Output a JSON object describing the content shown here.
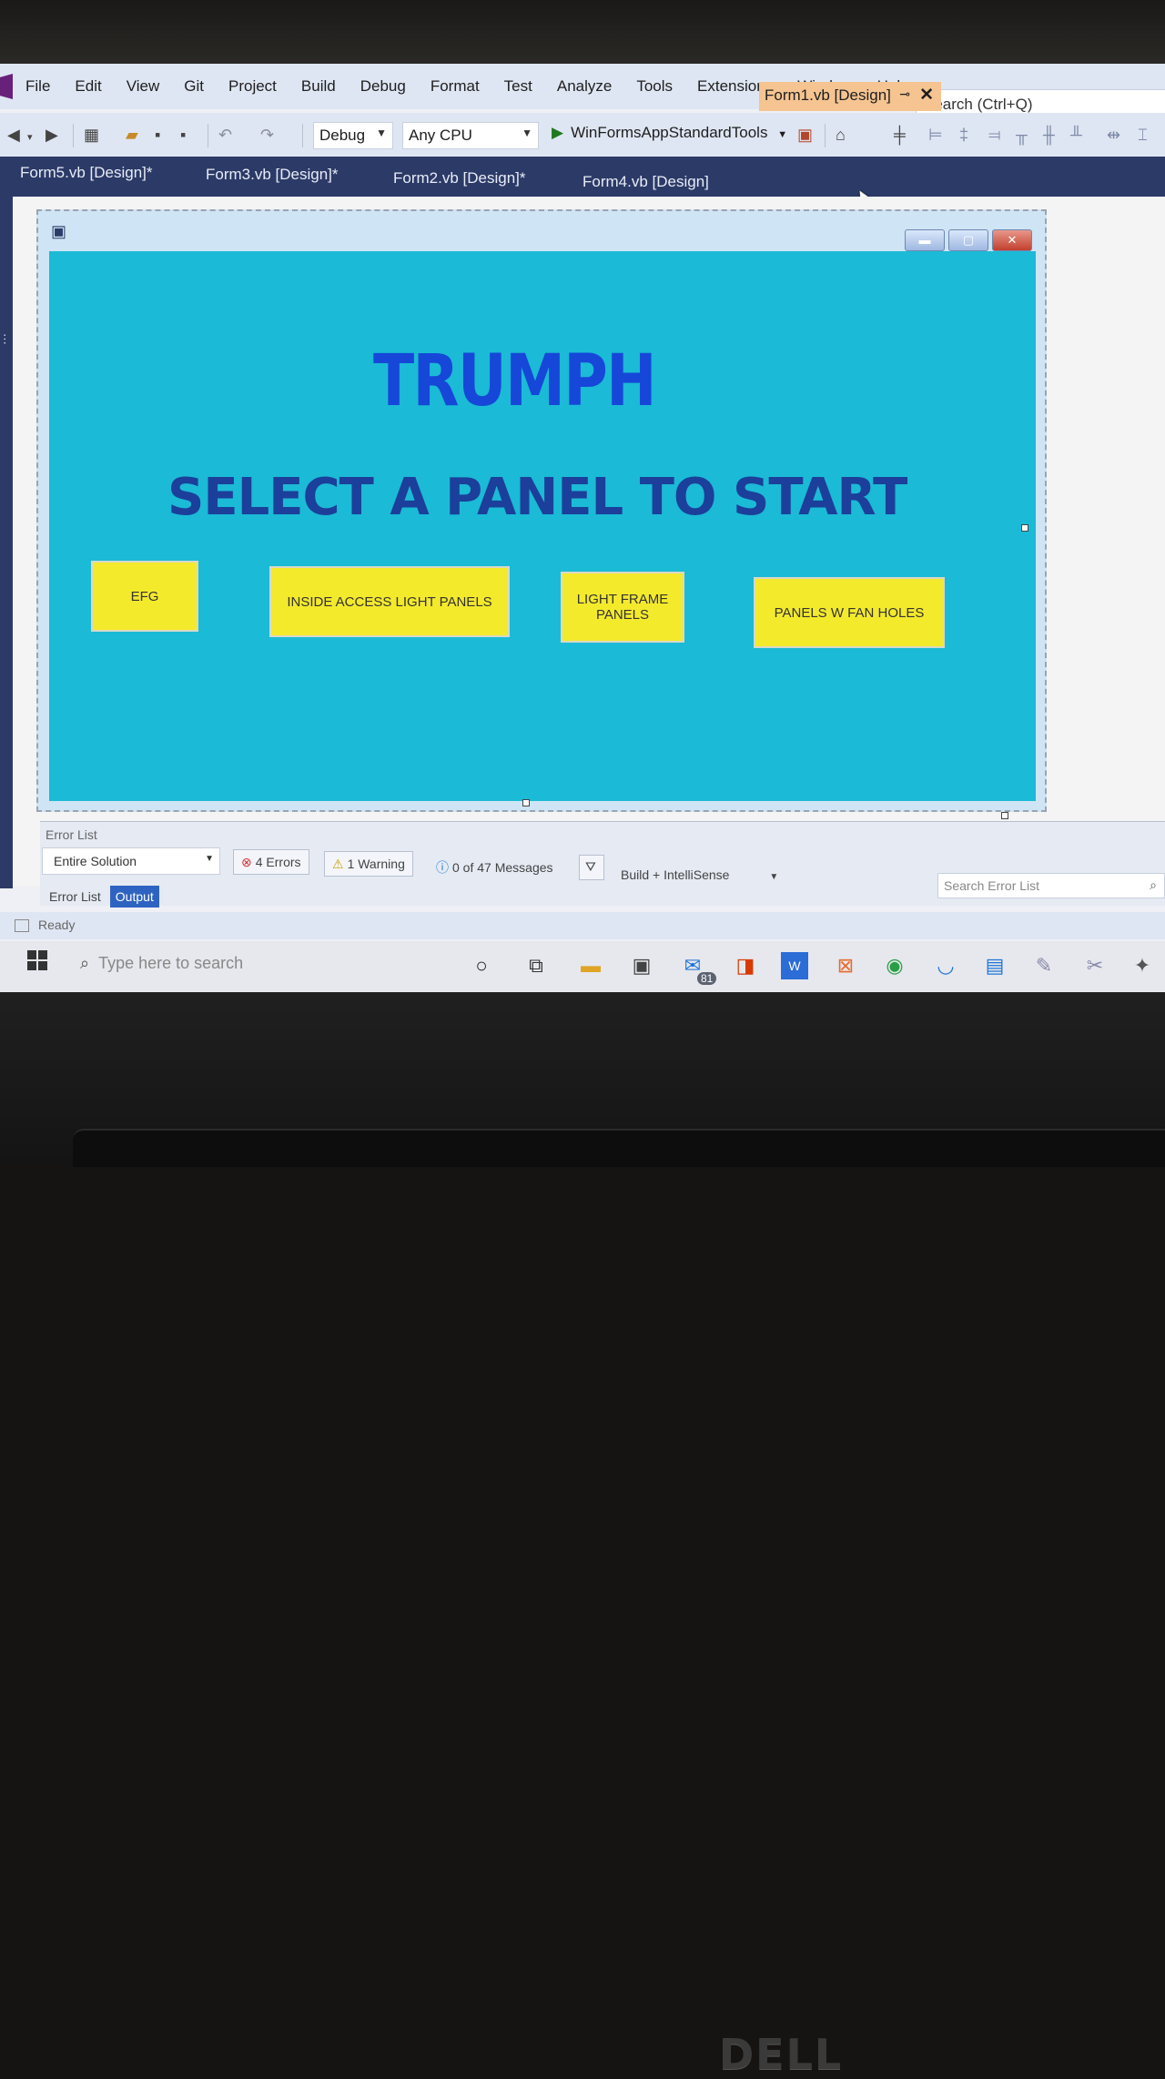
{
  "menu": {
    "items": [
      "File",
      "Edit",
      "View",
      "Git",
      "Project",
      "Build",
      "Debug",
      "Format",
      "Test",
      "Analyze",
      "Tools",
      "Extensions",
      "Window",
      "Help"
    ],
    "search_placeholder": "Search (Ctrl+Q)"
  },
  "toolbar": {
    "config": "Debug",
    "platform": "Any CPU",
    "startup_project": "WinFormsAppStandardTools"
  },
  "tabs": {
    "items": [
      "Form5.vb [Design]*",
      "Form3.vb [Design]*",
      "Form2.vb [Design]*",
      "Form4.vb [Design]"
    ],
    "active": "Form1.vb [Design]"
  },
  "form": {
    "title": "TRUMPH",
    "subtitle": "SELECT A PANEL TO START",
    "buttons": [
      "EFG",
      "INSIDE ACCESS LIGHT PANELS",
      "LIGHT FRAME PANELS",
      "PANELS W FAN HOLES"
    ],
    "colors": {
      "background": "#1bbad6",
      "button": "#f4ea2c",
      "title": "#1647d8",
      "subtitle": "#1b3f9a"
    }
  },
  "error_list": {
    "title": "Error List",
    "scope": "Entire Solution",
    "errors": "4 Errors",
    "warnings": "1 Warning",
    "messages": "0 of 47 Messages",
    "build_filter": "Build + IntelliSense",
    "search_placeholder": "Search Error List",
    "tabs": [
      "Error List",
      "Output"
    ]
  },
  "status": {
    "text": "Ready"
  },
  "taskbar": {
    "search_placeholder": "Type here to search",
    "mail_badge": "81"
  },
  "bezel": {
    "brand": "DELL"
  }
}
